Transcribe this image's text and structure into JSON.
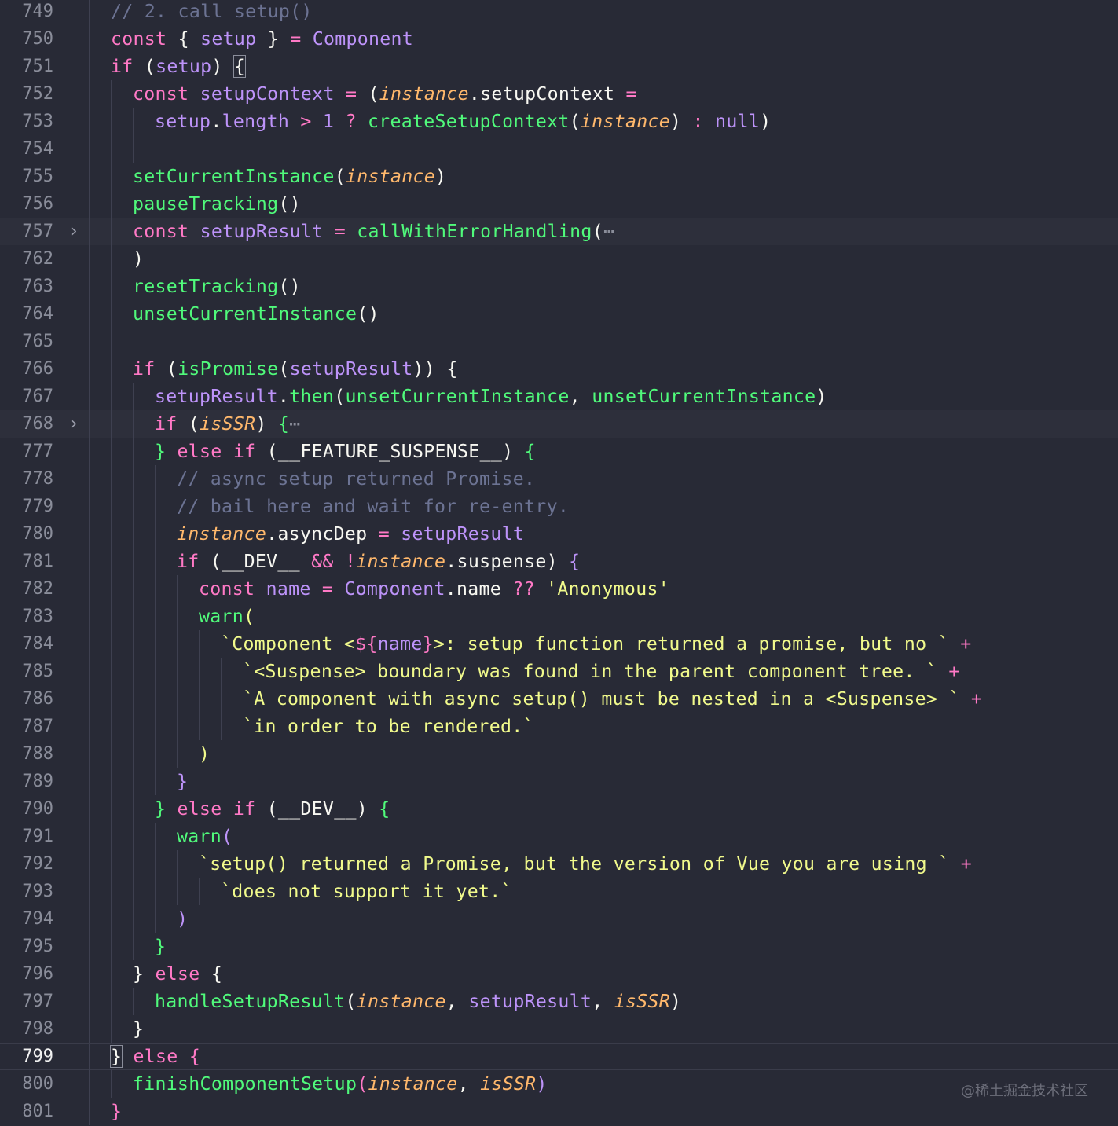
{
  "editor": {
    "current_line": "799",
    "lines": [
      {
        "n": "749",
        "indent": 1,
        "tokens": [
          {
            "t": "// 2. call setup()",
            "c": "cmt"
          }
        ]
      },
      {
        "n": "750",
        "indent": 1,
        "tokens": [
          {
            "t": "const",
            "c": "kw"
          },
          {
            "t": " { ",
            "c": "pun"
          },
          {
            "t": "setup",
            "c": "var"
          },
          {
            "t": " } ",
            "c": "pun"
          },
          {
            "t": "=",
            "c": "op"
          },
          {
            "t": " ",
            "c": "pl"
          },
          {
            "t": "Component",
            "c": "cls"
          }
        ]
      },
      {
        "n": "751",
        "indent": 1,
        "tokens": [
          {
            "t": "if",
            "c": "kw"
          },
          {
            "t": " (",
            "c": "pun"
          },
          {
            "t": "setup",
            "c": "var"
          },
          {
            "t": ") ",
            "c": "pun"
          },
          {
            "t": "{",
            "c": "brm"
          }
        ]
      },
      {
        "n": "752",
        "indent": 2,
        "tokens": [
          {
            "t": "const",
            "c": "kw"
          },
          {
            "t": " ",
            "c": "pl"
          },
          {
            "t": "setupContext",
            "c": "var"
          },
          {
            "t": " = ",
            "c": "op"
          },
          {
            "t": "(",
            "c": "pun"
          },
          {
            "t": "instance",
            "c": "prm"
          },
          {
            "t": ".setupContext ",
            "c": "pl"
          },
          {
            "t": "=",
            "c": "op"
          }
        ]
      },
      {
        "n": "753",
        "indent": 3,
        "tokens": [
          {
            "t": "setup",
            "c": "var"
          },
          {
            "t": ".",
            "c": "pl"
          },
          {
            "t": "length",
            "c": "var"
          },
          {
            "t": " > ",
            "c": "op"
          },
          {
            "t": "1",
            "c": "num"
          },
          {
            "t": " ? ",
            "c": "op"
          },
          {
            "t": "createSetupContext",
            "c": "fn"
          },
          {
            "t": "(",
            "c": "pun"
          },
          {
            "t": "instance",
            "c": "prm"
          },
          {
            "t": ")",
            "c": "pun"
          },
          {
            "t": " : ",
            "c": "op"
          },
          {
            "t": "null",
            "c": "num"
          },
          {
            "t": ")",
            "c": "pun"
          }
        ]
      },
      {
        "n": "754",
        "indent": 0,
        "tokens": []
      },
      {
        "n": "755",
        "indent": 2,
        "tokens": [
          {
            "t": "setCurrentInstance",
            "c": "fn"
          },
          {
            "t": "(",
            "c": "pun"
          },
          {
            "t": "instance",
            "c": "prm"
          },
          {
            "t": ")",
            "c": "pun"
          }
        ]
      },
      {
        "n": "756",
        "indent": 2,
        "tokens": [
          {
            "t": "pauseTracking",
            "c": "fn"
          },
          {
            "t": "()",
            "c": "pun"
          }
        ]
      },
      {
        "n": "757",
        "indent": 2,
        "folded": true,
        "tokens": [
          {
            "t": "const",
            "c": "kw"
          },
          {
            "t": " ",
            "c": "pl"
          },
          {
            "t": "setupResult",
            "c": "var"
          },
          {
            "t": " = ",
            "c": "op"
          },
          {
            "t": "callWithErrorHandling",
            "c": "fn"
          },
          {
            "t": "(",
            "c": "pun"
          },
          {
            "t": "⋯",
            "c": "dim"
          }
        ]
      },
      {
        "n": "762",
        "indent": 2,
        "tokens": [
          {
            "t": ")",
            "c": "pun"
          }
        ]
      },
      {
        "n": "763",
        "indent": 2,
        "tokens": [
          {
            "t": "resetTracking",
            "c": "fn"
          },
          {
            "t": "()",
            "c": "pun"
          }
        ]
      },
      {
        "n": "764",
        "indent": 2,
        "tokens": [
          {
            "t": "unsetCurrentInstance",
            "c": "fn"
          },
          {
            "t": "()",
            "c": "pun"
          }
        ]
      },
      {
        "n": "765",
        "indent": 0,
        "tokens": []
      },
      {
        "n": "766",
        "indent": 2,
        "tokens": [
          {
            "t": "if",
            "c": "kw"
          },
          {
            "t": " (",
            "c": "pun"
          },
          {
            "t": "isPromise",
            "c": "fn"
          },
          {
            "t": "(",
            "c": "pun"
          },
          {
            "t": "setupResult",
            "c": "var"
          },
          {
            "t": ")) ",
            "c": "pun"
          },
          {
            "t": "{",
            "c": "pun"
          }
        ]
      },
      {
        "n": "767",
        "indent": 3,
        "tokens": [
          {
            "t": "setupResult",
            "c": "var"
          },
          {
            "t": ".",
            "c": "pl"
          },
          {
            "t": "then",
            "c": "fn"
          },
          {
            "t": "(",
            "c": "pun"
          },
          {
            "t": "unsetCurrentInstance",
            "c": "fn"
          },
          {
            "t": ", ",
            "c": "pl"
          },
          {
            "t": "unsetCurrentInstance",
            "c": "fn"
          },
          {
            "t": ")",
            "c": "pun"
          }
        ]
      },
      {
        "n": "768",
        "indent": 3,
        "folded": true,
        "tokens": [
          {
            "t": "if",
            "c": "kw"
          },
          {
            "t": " (",
            "c": "pun"
          },
          {
            "t": "isSSR",
            "c": "prm"
          },
          {
            "t": ") ",
            "c": "pun"
          },
          {
            "t": "{",
            "c": "fn"
          },
          {
            "t": "⋯",
            "c": "dim"
          }
        ]
      },
      {
        "n": "777",
        "indent": 3,
        "tokens": [
          {
            "t": "}",
            "c": "fn"
          },
          {
            "t": " ",
            "c": "pl"
          },
          {
            "t": "else if",
            "c": "kw"
          },
          {
            "t": " (",
            "c": "pun"
          },
          {
            "t": "__FEATURE_SUSPENSE__",
            "c": "pl"
          },
          {
            "t": ") ",
            "c": "pun"
          },
          {
            "t": "{",
            "c": "fn"
          }
        ]
      },
      {
        "n": "778",
        "indent": 4,
        "tokens": [
          {
            "t": "// async setup returned Promise.",
            "c": "cmt"
          }
        ]
      },
      {
        "n": "779",
        "indent": 4,
        "tokens": [
          {
            "t": "// bail here and wait for re-entry.",
            "c": "cmt"
          }
        ]
      },
      {
        "n": "780",
        "indent": 4,
        "tokens": [
          {
            "t": "instance",
            "c": "prm"
          },
          {
            "t": ".asyncDep ",
            "c": "pl"
          },
          {
            "t": "=",
            "c": "op"
          },
          {
            "t": " ",
            "c": "pl"
          },
          {
            "t": "setupResult",
            "c": "var"
          }
        ]
      },
      {
        "n": "781",
        "indent": 4,
        "tokens": [
          {
            "t": "if",
            "c": "kw"
          },
          {
            "t": " (",
            "c": "pun"
          },
          {
            "t": "__DEV__",
            "c": "pl"
          },
          {
            "t": " && ",
            "c": "op"
          },
          {
            "t": "!",
            "c": "op"
          },
          {
            "t": "instance",
            "c": "prm"
          },
          {
            "t": ".suspense",
            "c": "pl"
          },
          {
            "t": ") ",
            "c": "pun"
          },
          {
            "t": "{",
            "c": "cls"
          }
        ]
      },
      {
        "n": "782",
        "indent": 5,
        "tokens": [
          {
            "t": "const",
            "c": "kw"
          },
          {
            "t": " ",
            "c": "pl"
          },
          {
            "t": "name",
            "c": "var"
          },
          {
            "t": " = ",
            "c": "op"
          },
          {
            "t": "Component",
            "c": "cls"
          },
          {
            "t": ".name ",
            "c": "pl"
          },
          {
            "t": "??",
            "c": "op"
          },
          {
            "t": " ",
            "c": "pl"
          },
          {
            "t": "'Anonymous'",
            "c": "str"
          }
        ]
      },
      {
        "n": "783",
        "indent": 5,
        "tokens": [
          {
            "t": "warn",
            "c": "fn"
          },
          {
            "t": "(",
            "c": "str"
          }
        ]
      },
      {
        "n": "784",
        "indent": 6,
        "tokens": [
          {
            "t": "`Component <",
            "c": "str"
          },
          {
            "t": "${",
            "c": "kw"
          },
          {
            "t": "name",
            "c": "var"
          },
          {
            "t": "}",
            "c": "kw"
          },
          {
            "t": ">: setup function returned a promise, but no `",
            "c": "str"
          },
          {
            "t": " +",
            "c": "op"
          }
        ]
      },
      {
        "n": "785",
        "indent": 7,
        "tokens": [
          {
            "t": "`<Suspense> boundary was found in the parent component tree. `",
            "c": "str"
          },
          {
            "t": " +",
            "c": "op"
          }
        ]
      },
      {
        "n": "786",
        "indent": 7,
        "tokens": [
          {
            "t": "`A component with async setup() must be nested in a <Suspense> `",
            "c": "str"
          },
          {
            "t": " +",
            "c": "op"
          }
        ]
      },
      {
        "n": "787",
        "indent": 7,
        "tokens": [
          {
            "t": "`in order to be rendered.`",
            "c": "str"
          }
        ]
      },
      {
        "n": "788",
        "indent": 5,
        "tokens": [
          {
            "t": ")",
            "c": "str"
          }
        ]
      },
      {
        "n": "789",
        "indent": 4,
        "tokens": [
          {
            "t": "}",
            "c": "cls"
          }
        ]
      },
      {
        "n": "790",
        "indent": 3,
        "tokens": [
          {
            "t": "}",
            "c": "fn"
          },
          {
            "t": " ",
            "c": "pl"
          },
          {
            "t": "else if",
            "c": "kw"
          },
          {
            "t": " (",
            "c": "pun"
          },
          {
            "t": "__DEV__",
            "c": "pl"
          },
          {
            "t": ") ",
            "c": "pun"
          },
          {
            "t": "{",
            "c": "fn"
          }
        ]
      },
      {
        "n": "791",
        "indent": 4,
        "tokens": [
          {
            "t": "warn",
            "c": "fn"
          },
          {
            "t": "(",
            "c": "cls"
          }
        ]
      },
      {
        "n": "792",
        "indent": 5,
        "tokens": [
          {
            "t": "`setup() returned a Promise, but the version of Vue you are using `",
            "c": "str"
          },
          {
            "t": " +",
            "c": "op"
          }
        ]
      },
      {
        "n": "793",
        "indent": 6,
        "tokens": [
          {
            "t": "`does not support it yet.`",
            "c": "str"
          }
        ]
      },
      {
        "n": "794",
        "indent": 4,
        "tokens": [
          {
            "t": ")",
            "c": "cls"
          }
        ]
      },
      {
        "n": "795",
        "indent": 3,
        "tokens": [
          {
            "t": "}",
            "c": "fn"
          }
        ]
      },
      {
        "n": "796",
        "indent": 2,
        "tokens": [
          {
            "t": "}",
            "c": "pun"
          },
          {
            "t": " ",
            "c": "pl"
          },
          {
            "t": "else",
            "c": "kw"
          },
          {
            "t": " ",
            "c": "pl"
          },
          {
            "t": "{",
            "c": "pun"
          }
        ]
      },
      {
        "n": "797",
        "indent": 3,
        "tokens": [
          {
            "t": "handleSetupResult",
            "c": "fn"
          },
          {
            "t": "(",
            "c": "pun"
          },
          {
            "t": "instance",
            "c": "prm"
          },
          {
            "t": ", ",
            "c": "pl"
          },
          {
            "t": "setupResult",
            "c": "var"
          },
          {
            "t": ", ",
            "c": "pl"
          },
          {
            "t": "isSSR",
            "c": "prm"
          },
          {
            "t": ")",
            "c": "pun"
          }
        ]
      },
      {
        "n": "798",
        "indent": 2,
        "tokens": [
          {
            "t": "}",
            "c": "pun"
          }
        ]
      },
      {
        "n": "799",
        "indent": 1,
        "tokens": [
          {
            "t": "}",
            "c": "brm"
          },
          {
            "t": " ",
            "c": "pl"
          },
          {
            "t": "else",
            "c": "kw"
          },
          {
            "t": " ",
            "c": "pl"
          },
          {
            "t": "{",
            "c": "kw"
          }
        ]
      },
      {
        "n": "800",
        "indent": 2,
        "tokens": [
          {
            "t": "finishComponentSetup",
            "c": "fn"
          },
          {
            "t": "(",
            "c": "kw"
          },
          {
            "t": "instance",
            "c": "prm"
          },
          {
            "t": ", ",
            "c": "pl"
          },
          {
            "t": "isSSR",
            "c": "prm"
          },
          {
            "t": ")",
            "c": "cls"
          }
        ]
      },
      {
        "n": "801",
        "indent": 1,
        "tokens": [
          {
            "t": "}",
            "c": "kw"
          }
        ]
      }
    ],
    "fold_icon": "chevron-right-icon",
    "fold_glyph": "›"
  },
  "watermark": "@稀土掘金技术社区",
  "colors": {
    "background": "#282a36",
    "keyword": "#ff79c6",
    "function": "#50fa7b",
    "variable": "#bd93f9",
    "parameter": "#ffb86c",
    "string": "#f1fa8c",
    "comment": "#6c7393"
  }
}
